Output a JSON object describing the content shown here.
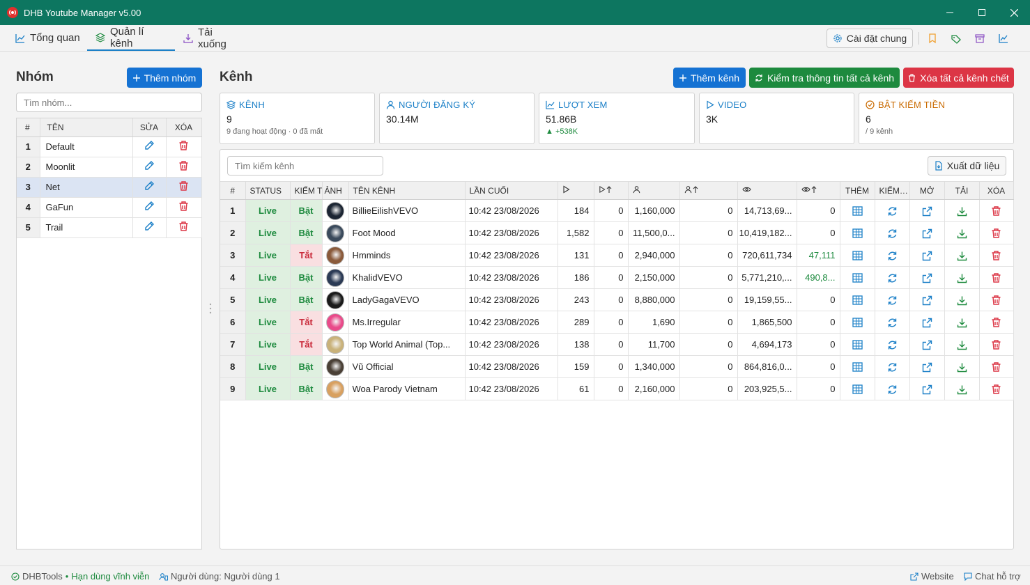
{
  "window": {
    "title": "DHB Youtube Manager v5.00"
  },
  "tabs": [
    {
      "label": "Tổng quan"
    },
    {
      "label": "Quản lí kênh"
    },
    {
      "label": "Tải xuống"
    }
  ],
  "toolbar": {
    "settings_label": "Cài đặt chung"
  },
  "groups": {
    "title": "Nhóm",
    "add_label": "Thêm nhóm",
    "search_placeholder": "Tìm nhóm...",
    "columns": [
      "#",
      "TÊN",
      "SỬA",
      "XÓA"
    ],
    "rows": [
      {
        "num": "1",
        "name": "Default"
      },
      {
        "num": "2",
        "name": "Moonlit"
      },
      {
        "num": "3",
        "name": "Net"
      },
      {
        "num": "4",
        "name": "GaFun"
      },
      {
        "num": "5",
        "name": "Trail"
      }
    ],
    "selected_index": 2
  },
  "channels": {
    "title": "Kênh",
    "add_label": "Thêm kênh",
    "check_all_label": "Kiểm tra thông tin tất cả kênh",
    "delete_dead_label": "Xóa tất cả kênh chết",
    "search_placeholder": "Tìm kiếm kênh",
    "export_label": "Xuất dữ liệu",
    "stats": [
      {
        "label": "KÊNH",
        "value": "9",
        "sub": "9 đang hoạt động · 0 đã mất",
        "color": "#1a7fc7"
      },
      {
        "label": "NGƯỜI ĐĂNG KÝ",
        "value": "30.14M",
        "sub": "",
        "color": "#1a7fc7"
      },
      {
        "label": "LƯỢT XEM",
        "value": "51.86B",
        "sub": "▲ +538K",
        "color": "#1a7fc7"
      },
      {
        "label": "VIDEO",
        "value": "3K",
        "sub": "",
        "color": "#1a7fc7"
      },
      {
        "label": "BẬT KIẾM TIỀN",
        "value": "6",
        "sub": "/ 9 kênh",
        "color": "#c96a00"
      }
    ],
    "columns": [
      "#",
      "STATUS",
      "KIẾM TIỀN",
      "ẢNH",
      "TÊN KÊNH",
      "LẦN CUỐI",
      "",
      "",
      "",
      "",
      "",
      "",
      "THÊM",
      "KIỂM TRA",
      "MỞ",
      "TẢI",
      "XÓA"
    ],
    "rows": [
      {
        "num": "1",
        "status": "Live",
        "monet": "Bật",
        "name": "BillieEilishVEVO",
        "last": "10:42 23/08/2026",
        "videos": "184",
        "videos_delta": "0",
        "subs": "1,160,000",
        "subs_delta": "0",
        "views": "14,713,69...",
        "views_delta": "0"
      },
      {
        "num": "2",
        "status": "Live",
        "monet": "Bật",
        "name": "Foot Mood",
        "last": "10:42 23/08/2026",
        "videos": "1,582",
        "videos_delta": "0",
        "subs": "11,500,0...",
        "subs_delta": "0",
        "views": "10,419,182...",
        "views_delta": "0"
      },
      {
        "num": "3",
        "status": "Live",
        "monet": "Tắt",
        "name": "Hmminds",
        "last": "10:42 23/08/2026",
        "videos": "131",
        "videos_delta": "0",
        "subs": "2,940,000",
        "subs_delta": "0",
        "views": "720,611,734",
        "views_delta": "47,111"
      },
      {
        "num": "4",
        "status": "Live",
        "monet": "Bật",
        "name": "KhalidVEVO",
        "last": "10:42 23/08/2026",
        "videos": "186",
        "videos_delta": "0",
        "subs": "2,150,000",
        "subs_delta": "0",
        "views": "5,771,210,...",
        "views_delta": "490,8..."
      },
      {
        "num": "5",
        "status": "Live",
        "monet": "Bật",
        "name": "LadyGagaVEVO",
        "last": "10:42 23/08/2026",
        "videos": "243",
        "videos_delta": "0",
        "subs": "8,880,000",
        "subs_delta": "0",
        "views": "19,159,55...",
        "views_delta": "0"
      },
      {
        "num": "6",
        "status": "Live",
        "monet": "Tắt",
        "name": "Ms.Irregular",
        "last": "10:42 23/08/2026",
        "videos": "289",
        "videos_delta": "0",
        "subs": "1,690",
        "subs_delta": "0",
        "views": "1,865,500",
        "views_delta": "0"
      },
      {
        "num": "7",
        "status": "Live",
        "monet": "Tắt",
        "name": "Top World Animal (Top...",
        "last": "10:42 23/08/2026",
        "videos": "138",
        "videos_delta": "0",
        "subs": "11,700",
        "subs_delta": "0",
        "views": "4,694,173",
        "views_delta": "0"
      },
      {
        "num": "8",
        "status": "Live",
        "monet": "Bật",
        "name": "Vũ Official",
        "last": "10:42 23/08/2026",
        "videos": "159",
        "videos_delta": "0",
        "subs": "1,340,000",
        "subs_delta": "0",
        "views": "864,816,0...",
        "views_delta": "0"
      },
      {
        "num": "9",
        "status": "Live",
        "monet": "Bật",
        "name": "Woa Parody Vietnam",
        "last": "10:42 23/08/2026",
        "videos": "61",
        "videos_delta": "0",
        "subs": "2,160,000",
        "subs_delta": "0",
        "views": "203,925,5...",
        "views_delta": "0"
      }
    ],
    "avatar_colors": [
      "#1c2533",
      "#3a4a5c",
      "#8a5a3a",
      "#2b3a55",
      "#1a1a1a",
      "#e94a8a",
      "#c9b27a",
      "#4a4036",
      "#d8a060"
    ]
  },
  "statusbar": {
    "brand": "DHBTools",
    "license": "Hạn dùng vĩnh viễn",
    "user": "Người dùng: Người dùng 1",
    "website": "Website",
    "support": "Chat hỗ trợ"
  },
  "colors": {
    "titlebar": "#0d7660",
    "primary": "#1572d3",
    "success": "#1d8a3e",
    "danger": "#dc3545"
  }
}
